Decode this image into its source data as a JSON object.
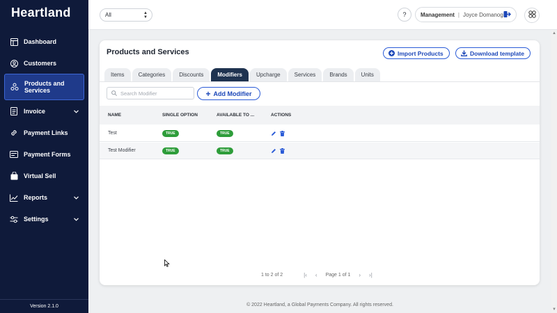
{
  "app": {
    "logo": "Heartland",
    "version": "Version 2.1.0"
  },
  "sidebar": {
    "items": [
      {
        "label": "Dashboard",
        "icon": "dashboard-icon"
      },
      {
        "label": "Customers",
        "icon": "customers-icon"
      },
      {
        "label": "Products and Services",
        "icon": "products-icon",
        "active": true
      },
      {
        "label": "Invoice",
        "icon": "invoice-icon",
        "expandable": true
      },
      {
        "label": "Payment Links",
        "icon": "link-icon"
      },
      {
        "label": "Payment Forms",
        "icon": "form-icon"
      },
      {
        "label": "Virtual Sell",
        "icon": "bag-icon"
      },
      {
        "label": "Reports",
        "icon": "chart-icon",
        "expandable": true
      },
      {
        "label": "Settings",
        "icon": "settings-icon",
        "expandable": true
      }
    ]
  },
  "topbar": {
    "filter_value": "All",
    "help": "?",
    "role": "Management",
    "user": "Joyce Domanog"
  },
  "page": {
    "title": "Products and Services",
    "import_label": "Import Products",
    "download_label": "Download template",
    "tabs": [
      "Items",
      "Categories",
      "Discounts",
      "Modifiers",
      "Upcharge",
      "Services",
      "Brands",
      "Units"
    ],
    "active_tab": "Modifiers",
    "search_placeholder": "Search Modifier",
    "add_label": "Add Modifier"
  },
  "table": {
    "columns": [
      "NAME",
      "SINGLE OPTION",
      "AVAILABLE TO ...",
      "ACTIONS"
    ],
    "rows": [
      {
        "name": "Test",
        "single_option": "TRUE",
        "available": "TRUE"
      },
      {
        "name": "Test Modifier",
        "single_option": "TRUE",
        "available": "TRUE"
      }
    ]
  },
  "pager": {
    "count": "1 to 2 of 2",
    "page": "Page 1 of 1"
  },
  "footer": "© 2022 Heartland, a Global Payments Company. All rights reserved.",
  "colors": {
    "sidebar": "#0f1a3a",
    "accent": "#2a5bd7",
    "badge": "#2e9d3a",
    "active_tab": "#1f3350"
  }
}
